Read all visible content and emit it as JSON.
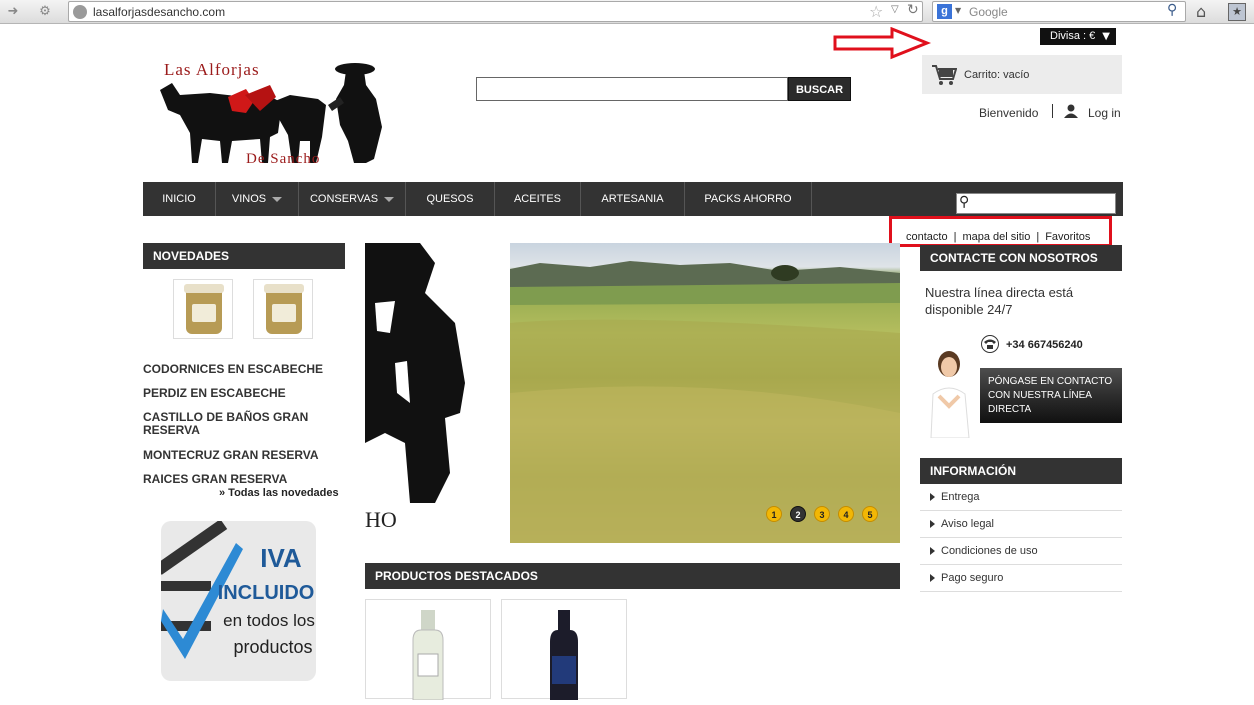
{
  "browser": {
    "url": "lasalforjasdesancho.com",
    "search_engine": "Google",
    "icons": [
      "back-icon",
      "tools-icon",
      "globe-icon",
      "star-icon",
      "reload-icon",
      "home-icon",
      "bookmarks-icon"
    ]
  },
  "header": {
    "logo_line1": "Las Alforjas",
    "logo_line2": "De Sancho",
    "search_value": "",
    "search_button": "BUSCAR",
    "currency": "Divisa : €",
    "cart": "Carrito: vacío",
    "welcome": "Bienvenido",
    "login": "Log in"
  },
  "nav": {
    "items": [
      "INICIO",
      "VINOS",
      "CONSERVAS",
      "QUESOS",
      "ACEITES",
      "ARTESANIA",
      "PACKS AHORRO"
    ],
    "search_value": ""
  },
  "links": {
    "contacto": "contacto",
    "mapa": "mapa del sitio",
    "favoritos": "Favoritos",
    "separator": "|"
  },
  "left": {
    "title": "NOVEDADES",
    "items": [
      "CODORNICES EN ESCABECHE",
      "PERDIZ EN ESCABECHE",
      "CASTILLO DE BAÑOS GRAN RESERVA",
      "MONTECRUZ GRAN RESERVA",
      "RAICES GRAN RESERVA"
    ],
    "all": "» Todas las novedades",
    "iva_line1": "IVA",
    "iva_line2": "INCLUIDO",
    "iva_line3": "en todos los",
    "iva_line4": "productos"
  },
  "center": {
    "slide_dots": [
      "1",
      "2",
      "3",
      "4",
      "5"
    ],
    "active_dot": 2,
    "slide_caption": "HO",
    "featured_title": "PRODUCTOS DESTACADOS"
  },
  "right": {
    "contact_title": "CONTACTE CON NOSOTROS",
    "line": "Nuestra línea directa está disponible 24/7",
    "phone": "+34 667456240",
    "contact_button": "PÓNGASE EN CONTACTO CON NUESTRA LÍNEA DIRECTA",
    "info_title": "INFORMACIÓN",
    "info_items": [
      "Entrega",
      "Aviso legal",
      "Condiciones de uso",
      "Pago seguro"
    ]
  },
  "colors": {
    "dark_bar": "#333333",
    "annotation_red": "#e0101c",
    "dot_yellow": "#f2b705"
  }
}
